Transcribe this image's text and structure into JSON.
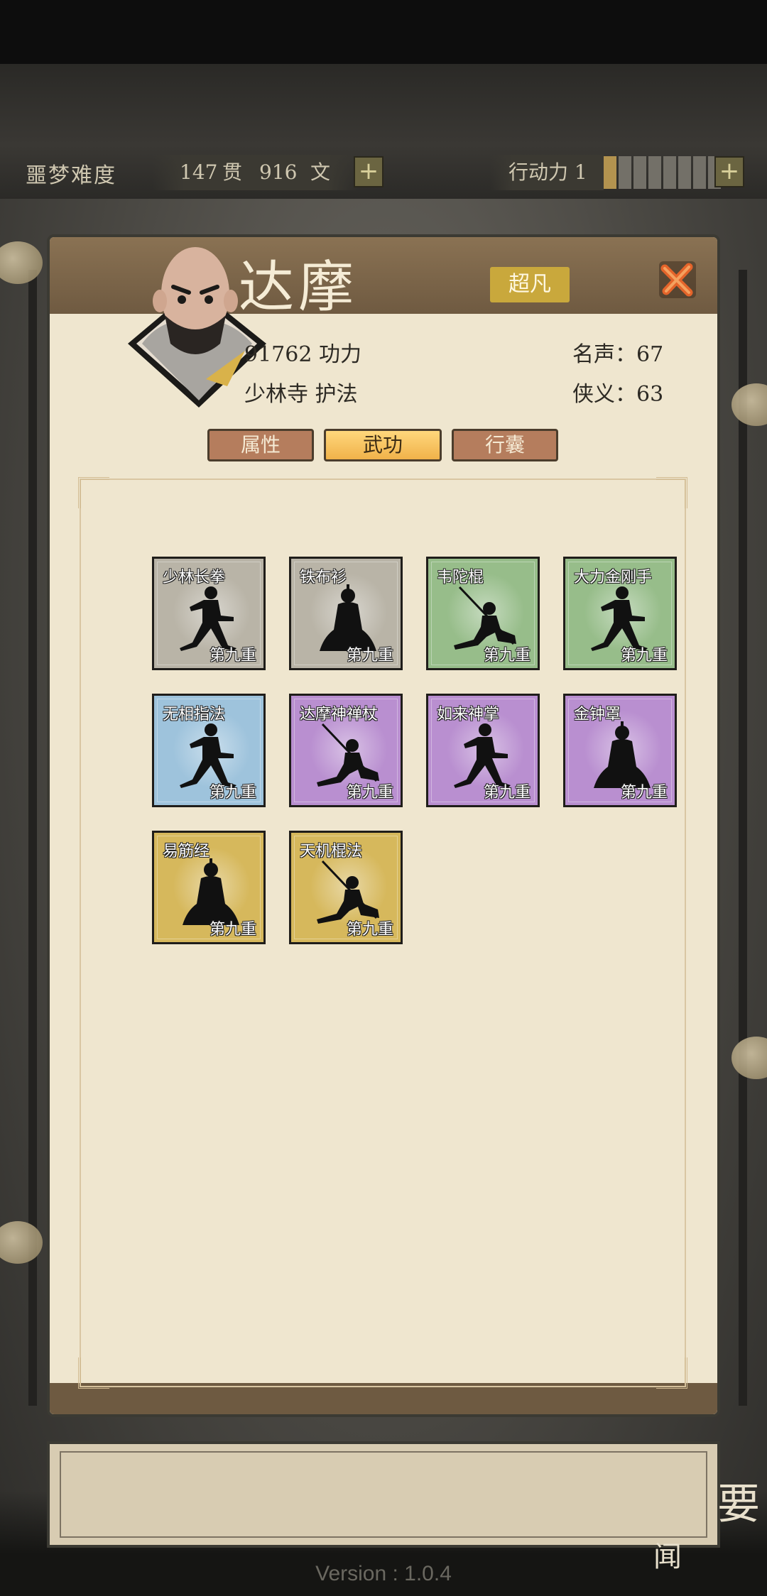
{
  "hud": {
    "difficulty": "噩梦难度",
    "money_guan": "147",
    "unit_guan": "贯",
    "money_wen": "916",
    "unit_wen": "文",
    "action_label": "行动力 1",
    "energy": {
      "filled": 1,
      "total": 8
    }
  },
  "hero": {
    "name": "达摩",
    "rank": "超凡",
    "power": "91762 功力",
    "sect": "少林寺 护法",
    "fame": "名声：67",
    "chivalry": "侠义：63"
  },
  "tabs": [
    {
      "label": "属性",
      "active": false
    },
    {
      "label": "武功",
      "active": true
    },
    {
      "label": "行囊",
      "active": false
    }
  ],
  "skills": [
    {
      "name": "少林长拳",
      "level": "第九重",
      "color": "#b9b4a7",
      "pose": "kick"
    },
    {
      "name": "铁布衫",
      "level": "第九重",
      "color": "#b9b4a7",
      "pose": "sit"
    },
    {
      "name": "韦陀棍",
      "level": "第九重",
      "color": "#97bd8a",
      "pose": "staff"
    },
    {
      "name": "大力金刚手",
      "level": "第九重",
      "color": "#97bd8a",
      "pose": "kick"
    },
    {
      "name": "无相指法",
      "level": "第九重",
      "color": "#9ec3dc",
      "pose": "kick"
    },
    {
      "name": "达摩神禅杖",
      "level": "第九重",
      "color": "#b98fd0",
      "pose": "staff"
    },
    {
      "name": "如来神掌",
      "level": "第九重",
      "color": "#b98fd0",
      "pose": "kick"
    },
    {
      "name": "金钟罩",
      "level": "第九重",
      "color": "#b98fd0",
      "pose": "sit"
    },
    {
      "name": "易筋经",
      "level": "第九重",
      "color": "#d6b85c",
      "pose": "sit"
    },
    {
      "name": "天机棍法",
      "level": "第九重",
      "color": "#d6b85c",
      "pose": "staff"
    }
  ],
  "side": {
    "right_glyph": "要",
    "bottom_glyph": "闻"
  },
  "version": "Version : 1.0.4"
}
